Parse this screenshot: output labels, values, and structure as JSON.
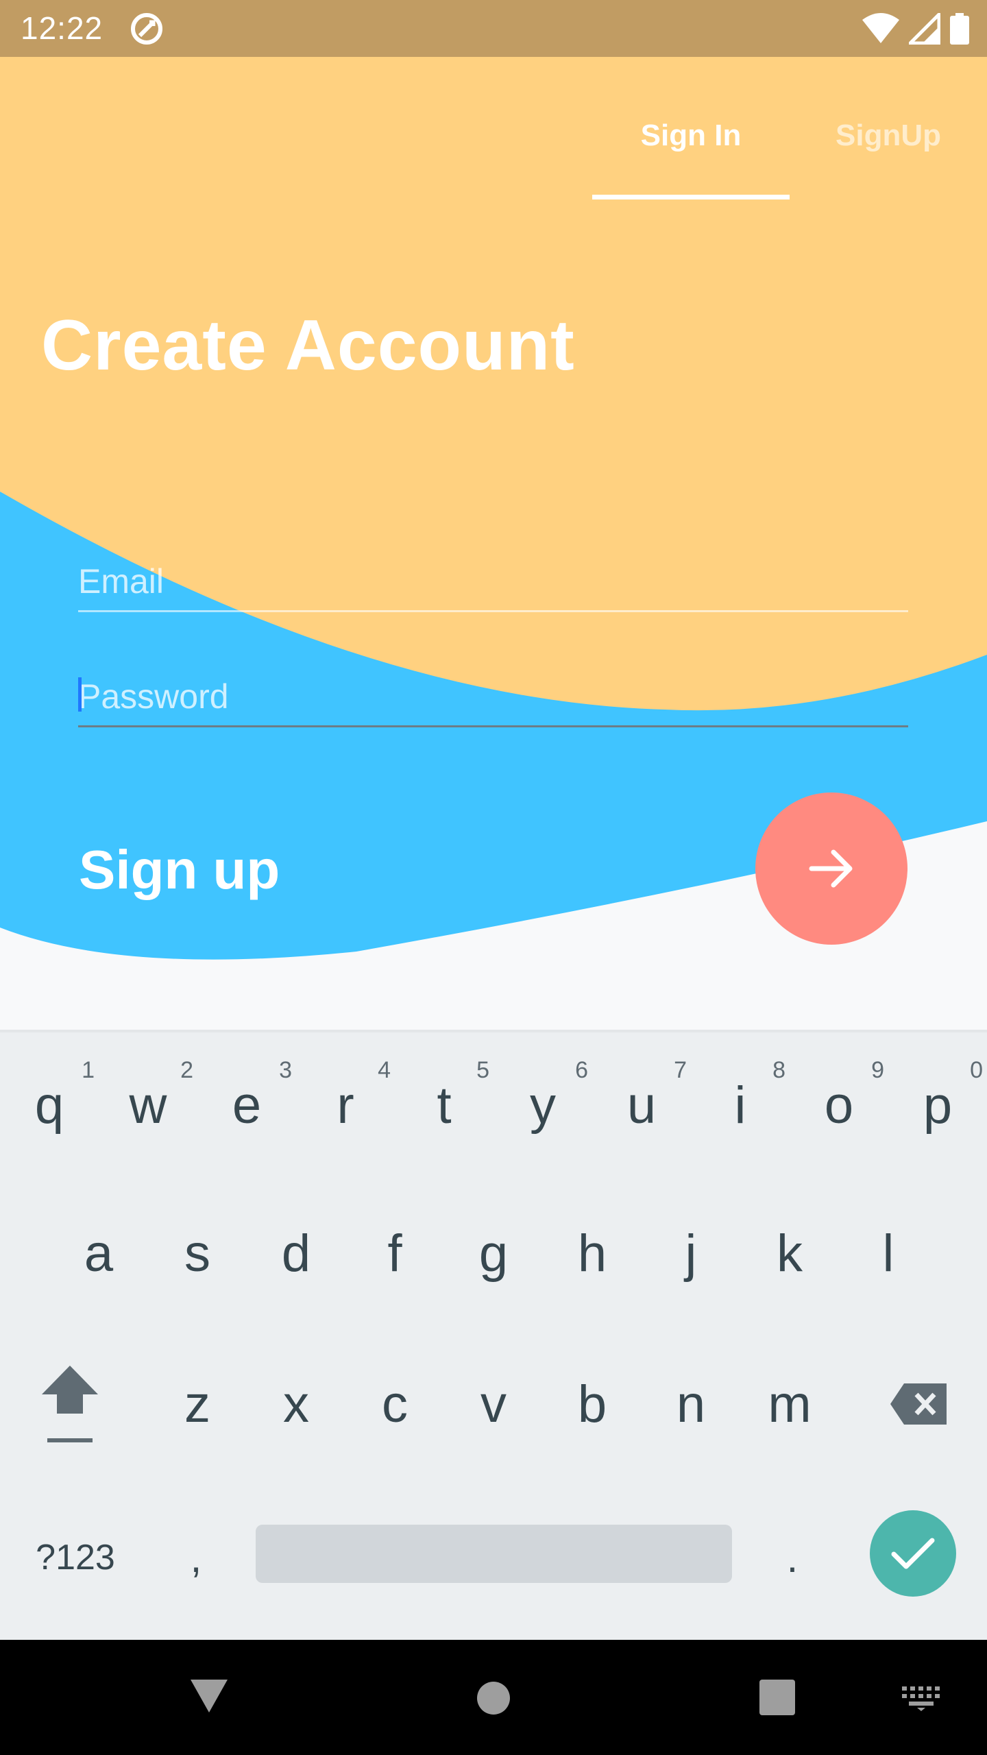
{
  "status_bar": {
    "time": "12:22",
    "app_icon": "quick-action-icon",
    "icons": [
      "wifi-icon",
      "signal-icon",
      "battery-icon"
    ]
  },
  "tabs": [
    {
      "label": "Sign In",
      "selected": true
    },
    {
      "label": "SignUp",
      "selected": false
    }
  ],
  "page_title": "Create Account",
  "form": {
    "email_placeholder": "Email",
    "email_value": "",
    "password_placeholder": "Password",
    "password_value": "",
    "submit_label": "Sign up",
    "submit_icon": "arrow-right-icon"
  },
  "keyboard": {
    "row1": [
      {
        "key": "q",
        "hint": "1"
      },
      {
        "key": "w",
        "hint": "2"
      },
      {
        "key": "e",
        "hint": "3"
      },
      {
        "key": "r",
        "hint": "4"
      },
      {
        "key": "t",
        "hint": "5"
      },
      {
        "key": "y",
        "hint": "6"
      },
      {
        "key": "u",
        "hint": "7"
      },
      {
        "key": "i",
        "hint": "8"
      },
      {
        "key": "o",
        "hint": "9"
      },
      {
        "key": "p",
        "hint": "0"
      }
    ],
    "row2": [
      "a",
      "s",
      "d",
      "f",
      "g",
      "h",
      "j",
      "k",
      "l"
    ],
    "row3": [
      "z",
      "x",
      "c",
      "v",
      "b",
      "n",
      "m"
    ],
    "symbols": "?123",
    "comma": ",",
    "period": ".",
    "shift_icon": "shift-icon",
    "backspace_icon": "backspace-icon",
    "done_icon": "check-icon"
  },
  "nav_bar": {
    "icons": [
      "back-icon",
      "home-icon",
      "recents-icon",
      "keyboard-switch-icon"
    ]
  },
  "colors": {
    "status_bar": "#c19c63",
    "header": "#ffd180",
    "wave": "#40c4ff",
    "background": "#f8f9fa",
    "submit_button": "#ff8a80",
    "keyboard": "#eceff1",
    "done_key": "#4db6ac"
  }
}
